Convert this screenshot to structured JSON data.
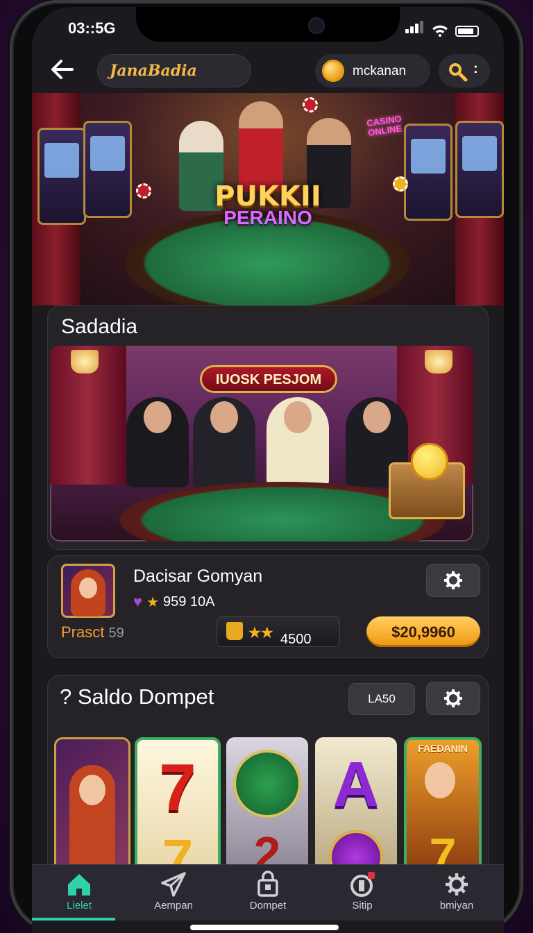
{
  "status": {
    "time": "03::5G"
  },
  "header": {
    "brand": "JanaBadia",
    "username": "mckanan"
  },
  "hero": {
    "title_line1": "PUKKII",
    "title_line2": "PERAINO",
    "neon": "CASINO ONLINE"
  },
  "featured": {
    "title": "Sadadia",
    "sign": "IUOSK PESJOM"
  },
  "player": {
    "name": "Dacisar Gomyan",
    "stats": "959 10A",
    "level_label": "Prasct",
    "level_num": "59",
    "stars_value": "4500",
    "balance": "$20,9960"
  },
  "wallet": {
    "title": "Saldo Dompet",
    "button": "LA50",
    "prefix": "?",
    "reel_banner": "FAEDANIN"
  },
  "nav": {
    "items": [
      {
        "label": "Lielet",
        "icon": "home-icon"
      },
      {
        "label": "Aempan",
        "icon": "send-icon"
      },
      {
        "label": "Dompet",
        "icon": "wallet-icon"
      },
      {
        "label": "Sitip",
        "icon": "shop-icon"
      },
      {
        "label": "bmiyan",
        "icon": "gear-icon"
      }
    ]
  },
  "colors": {
    "accent": "#2fd2a8",
    "gold": "#f0a21b",
    "brand": "#f2b84a"
  }
}
